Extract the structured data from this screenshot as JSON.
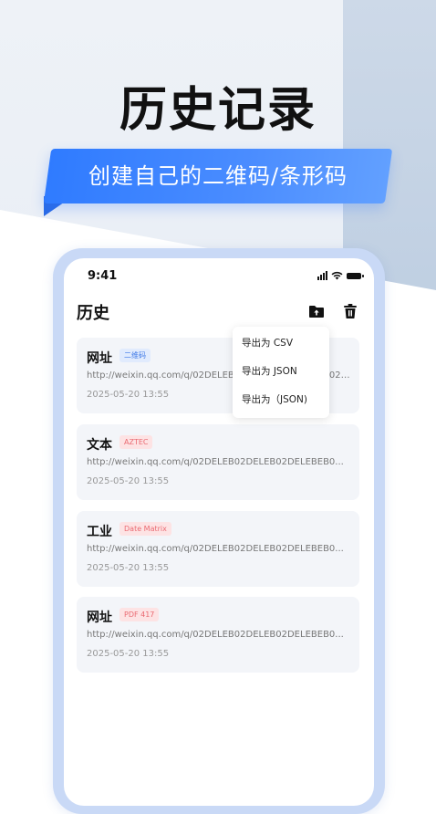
{
  "hero": {
    "title": "历史记录",
    "subtitle": "创建自己的二维码/条形码"
  },
  "status_bar": {
    "time": "9:41"
  },
  "header": {
    "title": "历史"
  },
  "icons": {
    "export": "folder-upload-icon",
    "delete": "trash-icon"
  },
  "export_menu": {
    "items": [
      "导出为 CSV",
      "导出为 JSON",
      "导出为（JSON)"
    ]
  },
  "records": [
    {
      "title": "网址",
      "tag": "二维码",
      "url": "http://weixin.qq.com/q/02DELEB02DELEB02DELEBEB02DELEBEB0...",
      "time": "2025-05-20 13:55"
    },
    {
      "title": "文本",
      "tag": "AZTEC",
      "url": "http://weixin.qq.com/q/02DELEB02DELEB02DELEBEB0...",
      "time": "2025-05-20 13:55"
    },
    {
      "title": "工业",
      "tag": "Date Matrix",
      "url": "http://weixin.qq.com/q/02DELEB02DELEB02DELEBEB0...",
      "time": "2025-05-20 13:55"
    },
    {
      "title": "网址",
      "tag": "PDF 417",
      "url": "http://weixin.qq.com/q/02DELEB02DELEB02DELEBEB0...",
      "time": "2025-05-20 13:55"
    }
  ],
  "colors": {
    "accent": "#2f7bff",
    "tag_blue": "#3f7ae8",
    "tag_red": "#ea6a72",
    "phone_frame": "#c9d9f6"
  }
}
